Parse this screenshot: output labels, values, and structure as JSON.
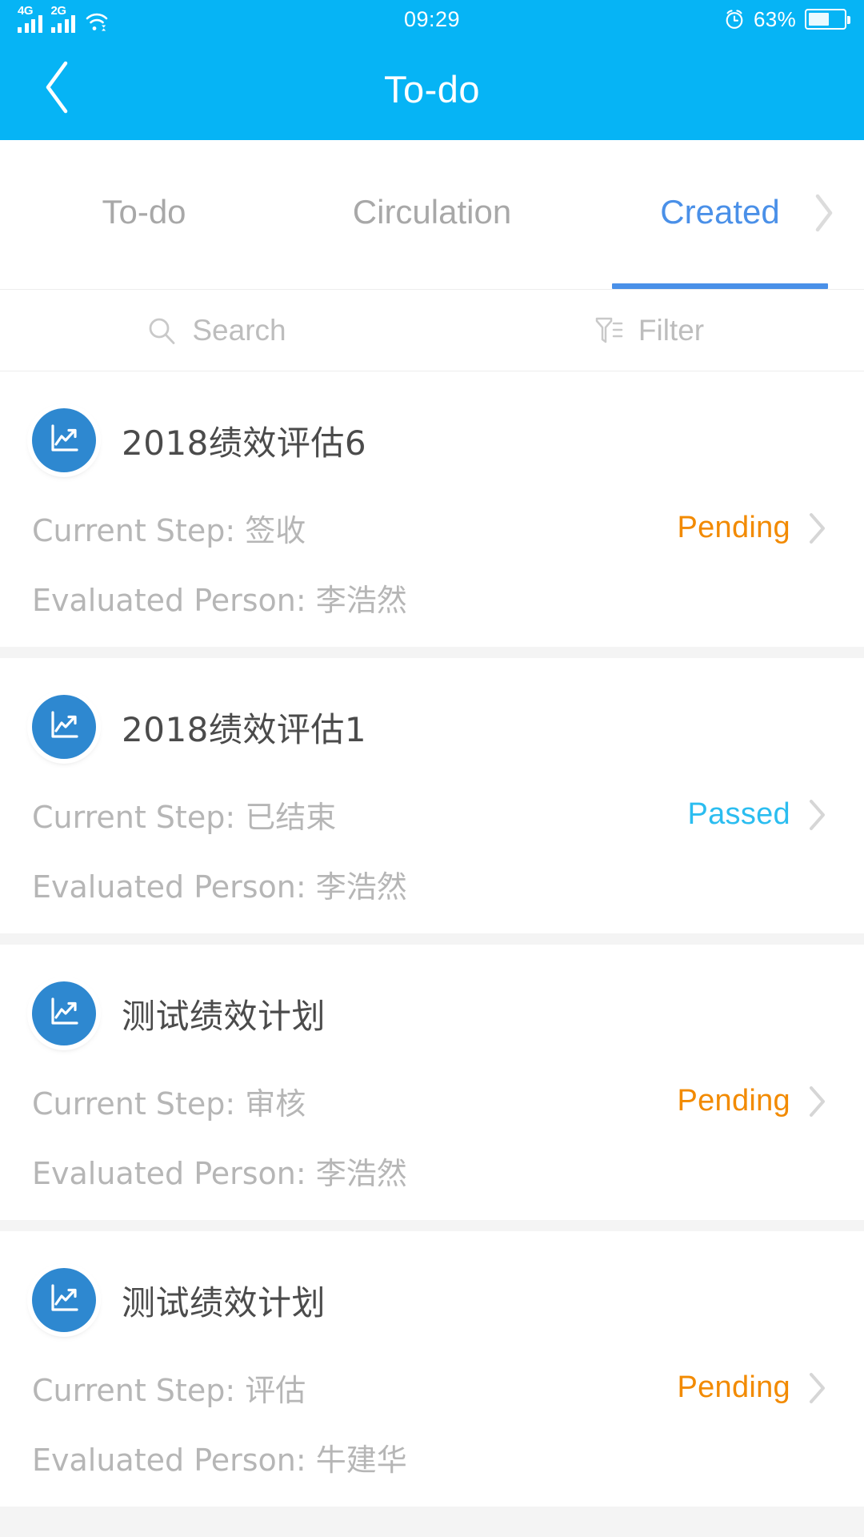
{
  "statusbar": {
    "signal_1_label": "4G",
    "signal_2_label": "2G",
    "wifi_icon": "wifi-icon",
    "time": "09:29",
    "alarm_icon": "alarm-clock-icon",
    "battery_percent": "63%",
    "battery_level": 60,
    "battery_icon": "battery-icon"
  },
  "header": {
    "back_icon": "back-chevron-icon",
    "title": "To-do",
    "background_color": "#06b4f5"
  },
  "tabs": {
    "items": [
      {
        "label": "To-do",
        "active": false
      },
      {
        "label": "Circulation",
        "active": false
      },
      {
        "label": "Created",
        "active": true
      }
    ],
    "next_icon": "chevron-right-icon",
    "active_color": "#4a90e8",
    "inactive_color": "#a8a8a8"
  },
  "toolbar": {
    "search_icon": "search-icon",
    "search_label": "Search",
    "filter_icon": "filter-icon",
    "filter_label": "Filter"
  },
  "list": {
    "labels": {
      "current_step": "Current Step:",
      "evaluated_person": "Evaluated Person:"
    },
    "status_colors": {
      "pending": "#f28a00",
      "passed": "#2bbdf0"
    },
    "avatar_icon": "line-chart-trending-up-icon",
    "avatar_color": "#2e88d0",
    "items": [
      {
        "title": "2018绩效评估6",
        "current_step": "签收",
        "evaluated_person": "李浩然",
        "status": "Pending",
        "status_kind": "pending"
      },
      {
        "title": "2018绩效评估1",
        "current_step": "已结束",
        "evaluated_person": "李浩然",
        "status": "Passed",
        "status_kind": "passed"
      },
      {
        "title": "测试绩效计划",
        "current_step": "审核",
        "evaluated_person": "李浩然",
        "status": "Pending",
        "status_kind": "pending"
      },
      {
        "title": "测试绩效计划",
        "current_step": "评估",
        "evaluated_person": "牛建华",
        "status": "Pending",
        "status_kind": "pending"
      }
    ]
  }
}
